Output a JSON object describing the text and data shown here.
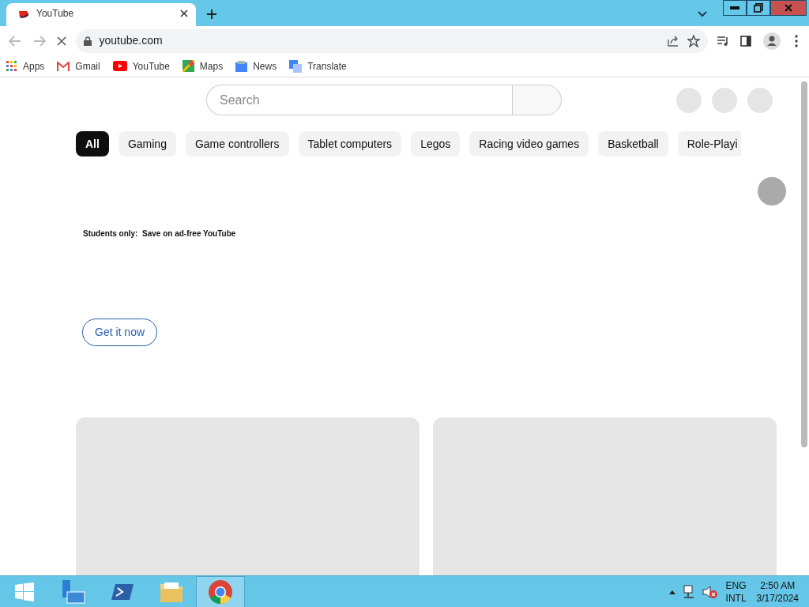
{
  "browser": {
    "tabs": [
      {
        "title": "YouTube",
        "selected": true
      }
    ],
    "address": "youtube.com",
    "loading": true,
    "bookmarks": [
      {
        "label": "Apps",
        "kind": "apps"
      },
      {
        "label": "Gmail",
        "kind": "mail"
      },
      {
        "label": "YouTube",
        "kind": "play"
      },
      {
        "label": "Maps",
        "kind": "map"
      },
      {
        "label": "News",
        "kind": "news"
      },
      {
        "label": "Translate",
        "kind": "translate"
      }
    ]
  },
  "page": {
    "search": {
      "placeholder": "Search"
    },
    "chips": [
      {
        "label": "All",
        "selected": true
      },
      {
        "label": "Gaming",
        "selected": false
      },
      {
        "label": "Game controllers",
        "selected": false
      },
      {
        "label": "Tablet computers",
        "selected": false
      },
      {
        "label": "Legos",
        "selected": false
      },
      {
        "label": "Racing video games",
        "selected": false
      },
      {
        "label": "Basketball",
        "selected": false
      },
      {
        "label": "Role-Playi",
        "selected": false
      }
    ],
    "promo": {
      "text": "Students only:  Save on ad-free YouTube",
      "button": "Get it now"
    }
  },
  "taskbar": {
    "language": "ENG",
    "layout": "INTL",
    "time": "2:50 AM",
    "date": "3/17/2024"
  }
}
